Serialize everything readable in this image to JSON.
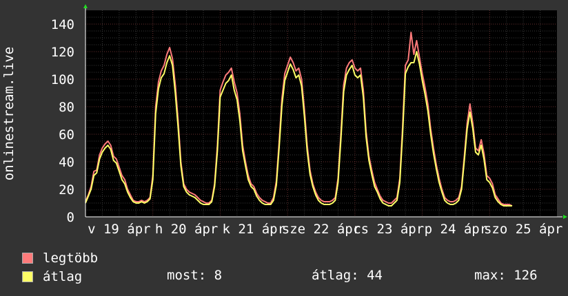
{
  "chart_data": {
    "type": "line",
    "title": "",
    "ylabel": "onlinestream.live",
    "xlabel": "",
    "ylim": [
      0,
      150
    ],
    "yticks": [
      0,
      20,
      40,
      60,
      80,
      100,
      120,
      140
    ],
    "xlim": [
      0,
      168
    ],
    "x_tick_labels": [
      {
        "x": 12,
        "label": "v 19 ápr"
      },
      {
        "x": 36,
        "label": "h 20 ápr"
      },
      {
        "x": 60,
        "label": "k 21 ápr"
      },
      {
        "x": 84,
        "label": "sze 22 ápr"
      },
      {
        "x": 108,
        "label": "cs 23 ápr"
      },
      {
        "x": 132,
        "label": "p 24 ápr"
      },
      {
        "x": 156,
        "label": "szo 25 ápr"
      }
    ],
    "grid": true,
    "x_hours": [
      0,
      1,
      2,
      3,
      4,
      5,
      6,
      7,
      8,
      9,
      10,
      11,
      12,
      13,
      14,
      15,
      16,
      17,
      18,
      19,
      20,
      21,
      22,
      23,
      24,
      25,
      26,
      27,
      28,
      29,
      30,
      31,
      32,
      33,
      34,
      35,
      36,
      37,
      38,
      39,
      40,
      41,
      42,
      43,
      44,
      45,
      46,
      47,
      48,
      49,
      50,
      51,
      52,
      53,
      54,
      55,
      56,
      57,
      58,
      59,
      60,
      61,
      62,
      63,
      64,
      65,
      66,
      67,
      68,
      69,
      70,
      71,
      72,
      73,
      74,
      75,
      76,
      77,
      78,
      79,
      80,
      81,
      82,
      83,
      84,
      85,
      86,
      87,
      88,
      89,
      90,
      91,
      92,
      93,
      94,
      95,
      96,
      97,
      98,
      99,
      100,
      101,
      102,
      103,
      104,
      105,
      106,
      107,
      108,
      109,
      110,
      111,
      112,
      113,
      114,
      115,
      116,
      117,
      118,
      119,
      120,
      121,
      122,
      123,
      124,
      125,
      126,
      127,
      128,
      129,
      130,
      131,
      132,
      133,
      134,
      135,
      136,
      137,
      138,
      139,
      140,
      141,
      142,
      143,
      144,
      145,
      146,
      147,
      148,
      149,
      150,
      151,
      152,
      153,
      154,
      155,
      156,
      157,
      158,
      159,
      160,
      161,
      162,
      163,
      164,
      165,
      166,
      167,
      168
    ],
    "series": [
      {
        "name": "legtöbb",
        "color": "#ff7b7b",
        "values": [
          11,
          16,
          22,
          33,
          34,
          45,
          50,
          53,
          55,
          52,
          44,
          42,
          36,
          30,
          27,
          20,
          16,
          12,
          11,
          11,
          12,
          11,
          12,
          14,
          30,
          80,
          98,
          106,
          110,
          118,
          123,
          115,
          96,
          70,
          40,
          24,
          20,
          18,
          17,
          16,
          14,
          12,
          11,
          10,
          10,
          12,
          24,
          52,
          92,
          98,
          103,
          105,
          108,
          98,
          90,
          75,
          52,
          40,
          30,
          24,
          22,
          17,
          14,
          12,
          11,
          10,
          10,
          14,
          26,
          54,
          86,
          104,
          110,
          116,
          112,
          106,
          108,
          100,
          78,
          52,
          34,
          24,
          18,
          14,
          12,
          11,
          11,
          11,
          12,
          14,
          28,
          60,
          96,
          108,
          112,
          114,
          108,
          106,
          108,
          92,
          62,
          44,
          34,
          25,
          20,
          15,
          12,
          11,
          10,
          10,
          12,
          14,
          28,
          66,
          110,
          114,
          134,
          118,
          128,
          116,
          104,
          94,
          82,
          64,
          50,
          38,
          28,
          20,
          14,
          12,
          11,
          11,
          12,
          14,
          22,
          44,
          68,
          82,
          68,
          50,
          48,
          56,
          46,
          30,
          28,
          24,
          16,
          13,
          10,
          9,
          9,
          9,
          8
        ]
      },
      {
        "name": "átlag",
        "color": "#ffff66",
        "values": [
          10,
          15,
          20,
          30,
          32,
          42,
          47,
          50,
          52,
          49,
          41,
          39,
          33,
          27,
          24,
          18,
          14,
          11,
          10,
          10,
          11,
          10,
          11,
          13,
          27,
          75,
          93,
          101,
          104,
          112,
          117,
          110,
          90,
          65,
          37,
          22,
          18,
          16,
          15,
          14,
          12,
          10,
          9,
          9,
          9,
          11,
          22,
          48,
          87,
          92,
          97,
          99,
          103,
          92,
          85,
          70,
          48,
          37,
          27,
          22,
          20,
          15,
          12,
          10,
          9,
          9,
          9,
          12,
          23,
          50,
          81,
          99,
          105,
          111,
          107,
          101,
          103,
          95,
          73,
          48,
          31,
          22,
          16,
          12,
          10,
          9,
          9,
          9,
          10,
          12,
          25,
          56,
          91,
          103,
          107,
          110,
          103,
          101,
          103,
          87,
          58,
          41,
          31,
          22,
          18,
          13,
          10,
          9,
          8,
          8,
          10,
          12,
          25,
          61,
          104,
          109,
          112,
          112,
          120,
          111,
          99,
          89,
          77,
          60,
          46,
          35,
          25,
          18,
          12,
          10,
          9,
          9,
          10,
          12,
          20,
          41,
          64,
          76,
          64,
          47,
          45,
          52,
          42,
          27,
          25,
          21,
          14,
          11,
          9,
          8,
          8,
          8,
          8
        ]
      }
    ]
  },
  "legend": {
    "items": [
      {
        "label": "legtöbb",
        "color": "#ff7b7b"
      },
      {
        "label": "átlag",
        "color": "#ffff66"
      }
    ]
  },
  "stats": {
    "most": "most: 8",
    "atlag": "átlag: 44",
    "max": "max: 126"
  }
}
